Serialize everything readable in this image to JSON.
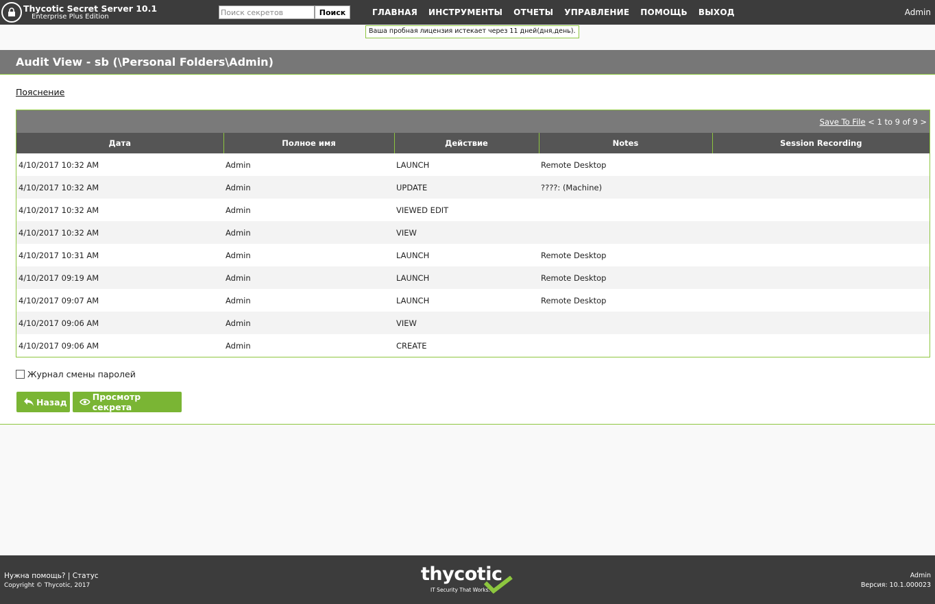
{
  "header": {
    "app_title": "Thycotic Secret Server 10.1",
    "edition": "Enterprise Plus Edition",
    "search_placeholder": "Поиск секретов",
    "search_button": "Поиск",
    "nav": [
      "ГЛАВНАЯ",
      "ИНСТРУМЕНТЫ",
      "ОТЧЕТЫ",
      "УПРАВЛЕНИЕ",
      "ПОМОЩЬ",
      "ВЫХОД"
    ],
    "user": "Admin",
    "license_notice": "Ваша пробная лицензия истекает через 11 дней(дня,день)."
  },
  "page": {
    "title": "Audit View - sb (\\Personal Folders\\Admin)",
    "explain_link": "Пояснение"
  },
  "grid": {
    "save_link": "Save To File",
    "pager": "< 1 to 9 of 9 >",
    "columns": [
      "Дата",
      "Полное имя",
      "Действие",
      "Notes",
      "Session Recording"
    ],
    "rows": [
      [
        "4/10/2017 10:32 AM",
        "Admin",
        "LAUNCH",
        "Remote Desktop",
        ""
      ],
      [
        "4/10/2017 10:32 AM",
        "Admin",
        "UPDATE",
        "????: (Machine)",
        ""
      ],
      [
        "4/10/2017 10:32 AM",
        "Admin",
        "VIEWED EDIT",
        "",
        ""
      ],
      [
        "4/10/2017 10:32 AM",
        "Admin",
        "VIEW",
        "",
        ""
      ],
      [
        "4/10/2017 10:31 AM",
        "Admin",
        "LAUNCH",
        "Remote Desktop",
        ""
      ],
      [
        "4/10/2017 09:19 AM",
        "Admin",
        "LAUNCH",
        "Remote Desktop",
        ""
      ],
      [
        "4/10/2017 09:07 AM",
        "Admin",
        "LAUNCH",
        "Remote Desktop",
        ""
      ],
      [
        "4/10/2017 09:06 AM",
        "Admin",
        "VIEW",
        "",
        ""
      ],
      [
        "4/10/2017 09:06 AM",
        "Admin",
        "CREATE",
        "",
        ""
      ]
    ]
  },
  "options": {
    "password_log_label": "Журнал смены паролей",
    "password_log_checked": false
  },
  "buttons": {
    "back": "Назад",
    "view_secret": "Просмотр секрета"
  },
  "footer": {
    "help": "Нужна помощь? | Статус",
    "copyright": "Copyright © Thycotic, 2017",
    "logo_word": "thycotic",
    "logo_tagline": "IT Security That Works.",
    "user": "Admin",
    "version": "Версия: 10.1.000023"
  },
  "colors": {
    "accent": "#8dc63f",
    "button": "#7ab534",
    "topbar": "#3c3c3c",
    "titlebar": "#777777",
    "header_row": "#555555"
  }
}
